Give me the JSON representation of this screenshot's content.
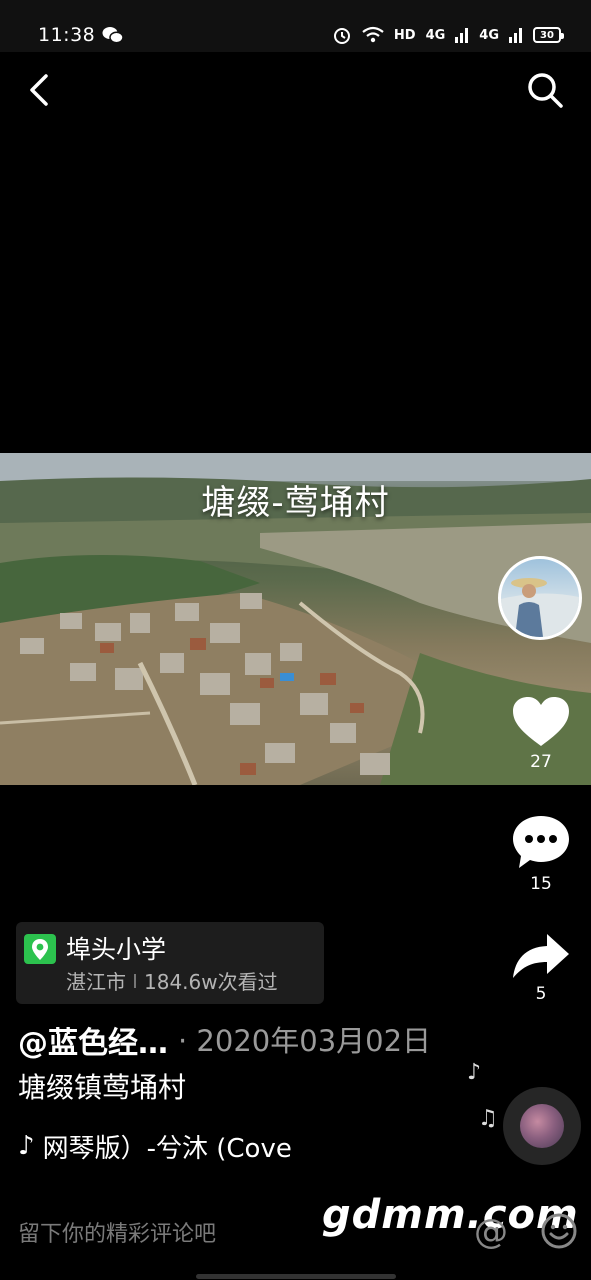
{
  "status_bar": {
    "time": "11:38",
    "network": "HD",
    "signal1": "4G",
    "signal2": "4G",
    "battery": "30",
    "icons": [
      "wechat-icon",
      "alarm-icon",
      "wifi-icon",
      "signal-icon",
      "battery-icon"
    ]
  },
  "header": {
    "back_icon": "chevron-left-icon",
    "search_icon": "search-icon"
  },
  "video": {
    "caption": "塘缀-莺埇村"
  },
  "actions": {
    "like_count": "27",
    "comment_count": "15",
    "share_count": "5"
  },
  "location": {
    "name": "埠头小学",
    "city": "湛江市",
    "views": "184.6w次看过"
  },
  "post": {
    "author": "@蓝色经…",
    "date": "· 2020年03月02日",
    "description": "塘缀镇莺埇村",
    "music": "网琴版）-兮沐 (Cove"
  },
  "comment_bar": {
    "placeholder": "留下你的精彩评论吧"
  },
  "watermark": "gdmm.com",
  "colors": {
    "background": "#000000",
    "location_pin": "#2cc24e"
  }
}
